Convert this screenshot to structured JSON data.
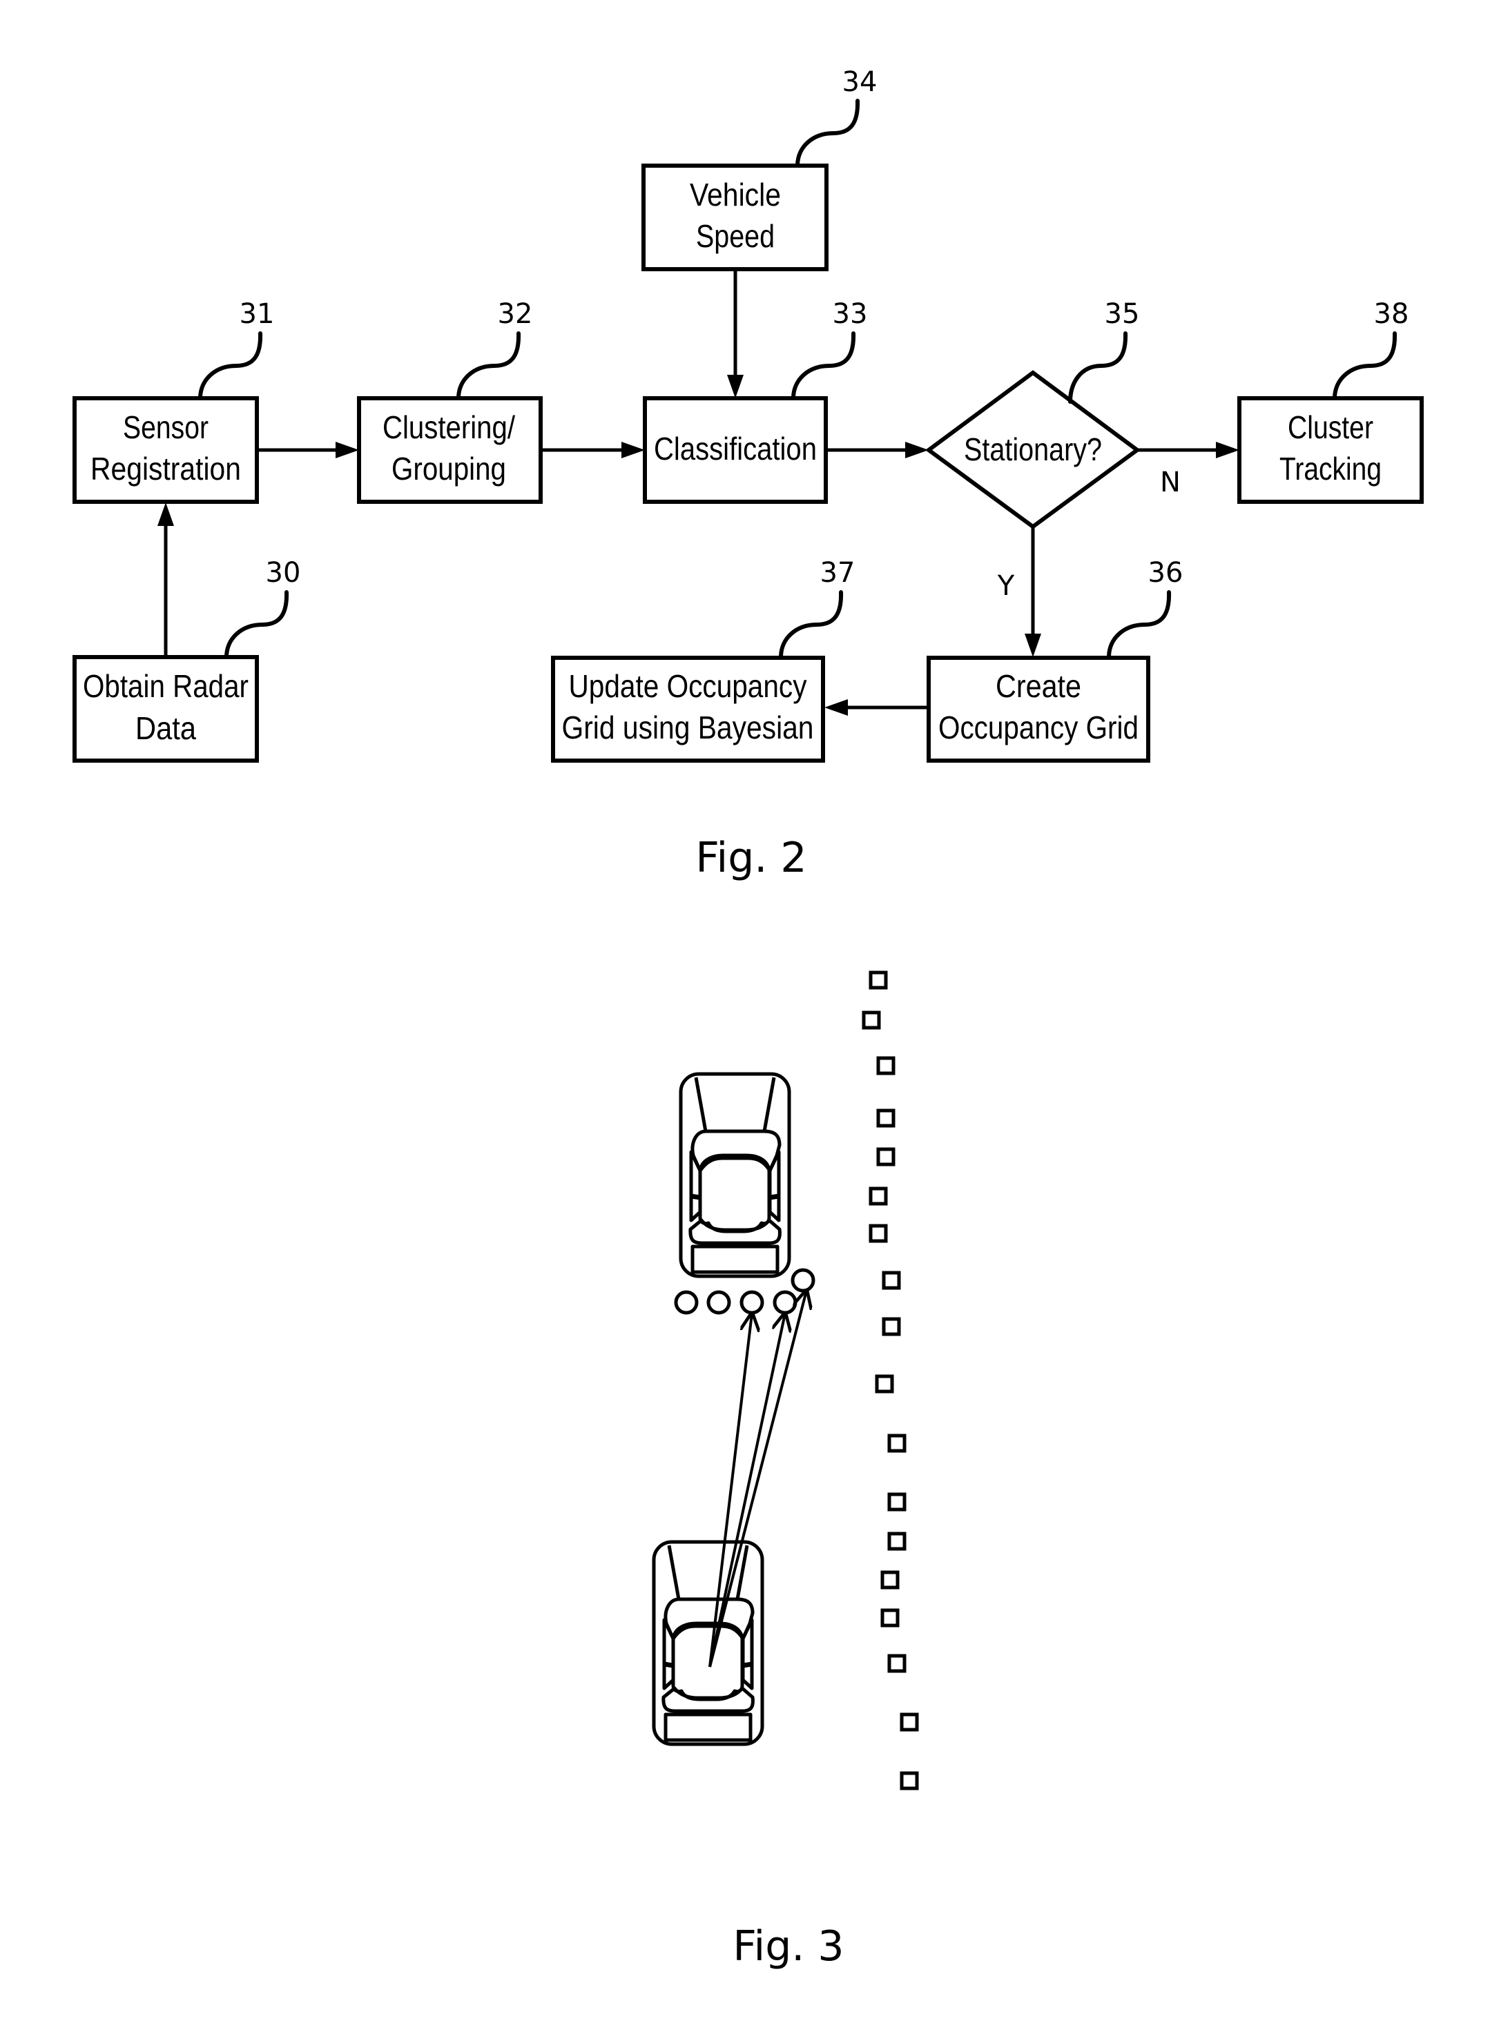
{
  "fig2": {
    "caption": "Fig. 2",
    "blocks": {
      "obtain": {
        "ref": "30",
        "lines": [
          "Obtain Radar",
          "Data"
        ]
      },
      "sensor": {
        "ref": "31",
        "lines": [
          "Sensor",
          "Registration"
        ]
      },
      "cluster": {
        "ref": "32",
        "lines": [
          "Clustering/",
          "Grouping"
        ]
      },
      "classify": {
        "ref": "33",
        "lines": [
          "Classification"
        ]
      },
      "speed": {
        "ref": "34",
        "lines": [
          "Vehicle",
          "Speed"
        ]
      },
      "decision": {
        "ref": "35",
        "lines": [
          "Stationary?"
        ]
      },
      "create": {
        "ref": "36",
        "lines": [
          "Create",
          "Occupancy Grid"
        ]
      },
      "update": {
        "ref": "37",
        "lines": [
          "Update Occupancy",
          "Grid using Bayesian"
        ]
      },
      "tracking": {
        "ref": "38",
        "lines": [
          "Cluster",
          "Tracking"
        ]
      }
    },
    "branch_yes": "Y",
    "branch_no": "N"
  },
  "fig3": {
    "caption": "Fig. 3",
    "stationary_detections_count": 18,
    "target_vehicle_detections_count": 5,
    "rays_count": 3
  }
}
